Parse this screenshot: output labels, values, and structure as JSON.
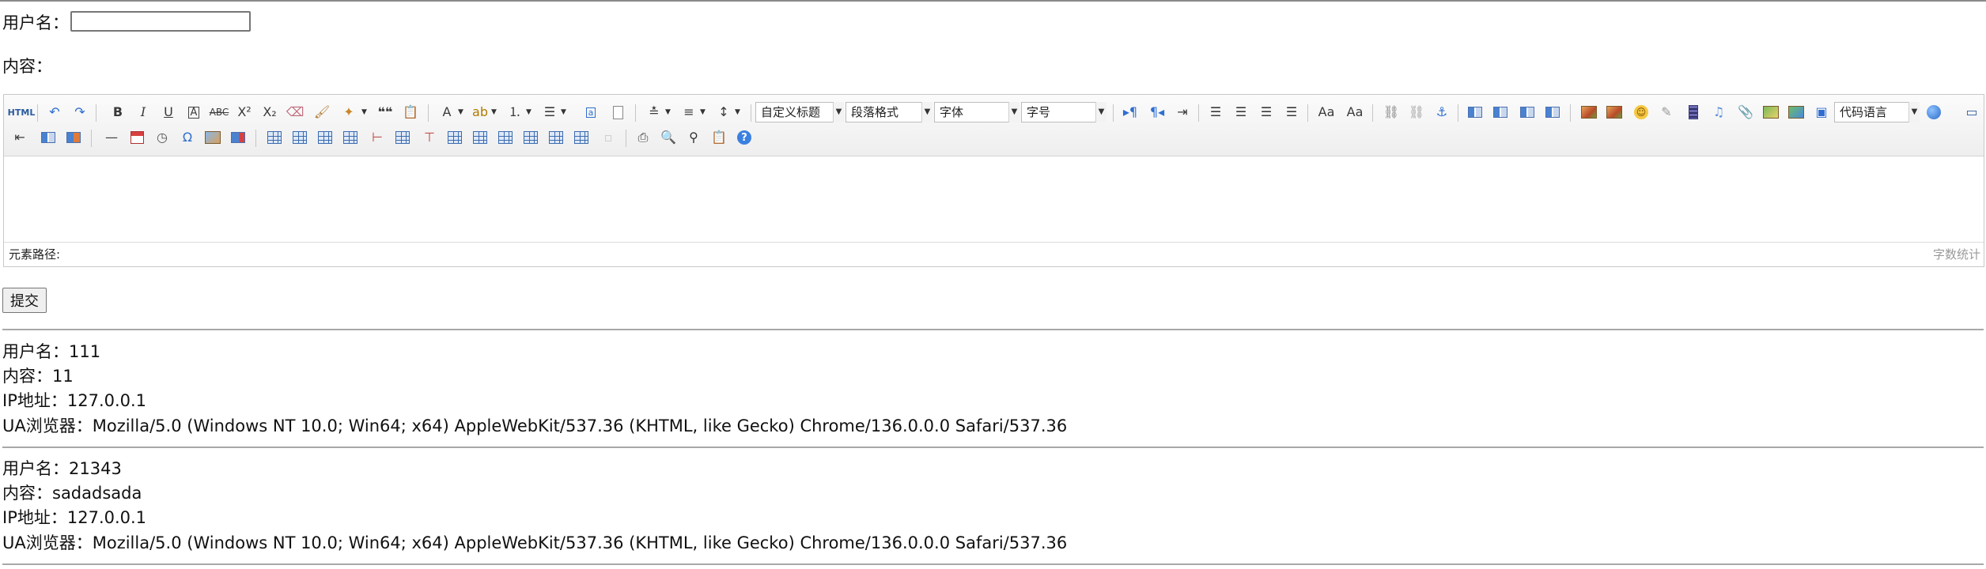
{
  "form": {
    "username_label": "用户名：",
    "username_value": "",
    "content_label": "内容："
  },
  "editor": {
    "selects": {
      "custom_title": "自定义标题",
      "paragraph": "段落格式",
      "font_family": "字体",
      "font_size": "字号",
      "code_language": "代码语言"
    },
    "html_label": "HTML",
    "path_label": "元素路径:",
    "word_count": "字数统计"
  },
  "submit_label": "提交",
  "entries": [
    {
      "username": "用户名：111",
      "content": "内容：11",
      "ip": "IP地址：127.0.0.1",
      "ua": "UA浏览器：Mozilla/5.0 (Windows NT 10.0; Win64; x64) AppleWebKit/537.36 (KHTML, like Gecko) Chrome/136.0.0.0 Safari/537.36"
    },
    {
      "username": "用户名：21343",
      "content": "内容：sadadsada",
      "ip": "IP地址：127.0.0.1",
      "ua": "UA浏览器：Mozilla/5.0 (Windows NT 10.0; Win64; x64) AppleWebKit/537.36 (KHTML, like Gecko) Chrome/136.0.0.0 Safari/537.36"
    }
  ]
}
